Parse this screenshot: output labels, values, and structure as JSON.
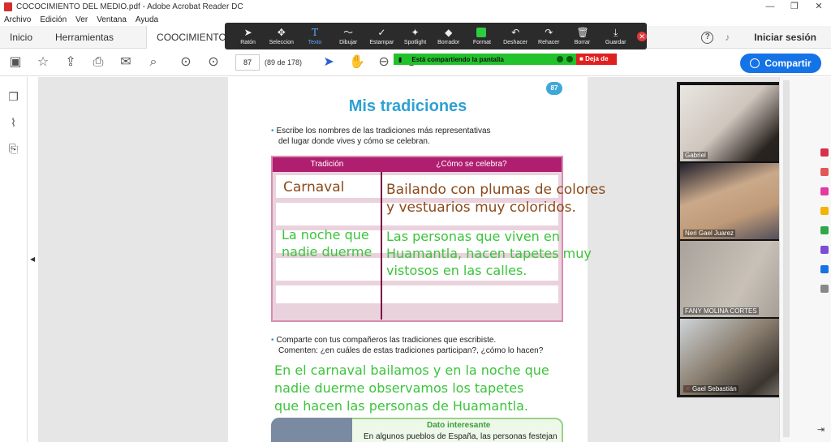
{
  "window": {
    "title": "COCOCIMIENTO DEL MEDIO.pdf - Adobe Acrobat Reader DC"
  },
  "menu": [
    "Archivo",
    "Edición",
    "Ver",
    "Ventana",
    "Ayuda"
  ],
  "tabs": {
    "home": "Inicio",
    "tools": "Herramientas",
    "doc": "COOCIMIENTO DE..."
  },
  "header": {
    "signin": "Iniciar sesión",
    "share_button": "Compartir"
  },
  "toolbar": {
    "page_value": "87",
    "page_of": "(89 de 178)"
  },
  "zoom_toolbar": {
    "tools": [
      "Ratón",
      "Seleccion",
      "Texto",
      "Dibujar",
      "Estampar",
      "Spotlight",
      "Borrador",
      "Format",
      "Deshacer",
      "Rehacer",
      "Borrar",
      "Guardar"
    ],
    "active_tool": "Texto"
  },
  "sharing": {
    "banner": "Está compartiendo la pantalla",
    "stop": "Deja de"
  },
  "page": {
    "number": "87",
    "title": "Mis tradiciones",
    "instruction_1_line1": "Escribe los nombres de las tradiciones más representativas",
    "instruction_1_line2": "del lugar donde vives y cómo se celebran.",
    "table_header_1": "Tradición",
    "table_header_2": "¿Cómo se celebra?",
    "instruction_2_line1": "Comparte con tus compañeros las tradiciones que escribiste.",
    "instruction_2_line2": "Comenten: ¿en cuáles de estas tradiciones participan?, ¿cómo lo hacen?",
    "dato_title": "Dato interesante",
    "dato_text": "En algunos pueblos de España, las personas festejan"
  },
  "handwriting": {
    "row1_tradition": "Carnaval",
    "row1_line1": "Bailando con plumas de colores",
    "row1_line2": "y vestuarios muy coloridos.",
    "row2_line1": "La noche que",
    "row2_line2": "nadie duerme",
    "row2_desc_line1": "Las personas que viven en",
    "row2_desc_line2": "Huamantla, hacen tapetes muy",
    "row2_desc_line3": "vistosos en las calles.",
    "answer_line1": "En el carnaval bailamos y en la noche que",
    "answer_line2": "nadie duerme observamos los tapetes",
    "answer_line3": "que hacen las personas de Huamantla."
  },
  "participants": [
    "Gabriel",
    "Neri Gael Juarez",
    "FANY MOLINA CORTES",
    "Gael Sebastián"
  ],
  "colors": {
    "accent_blue": "#1473e6",
    "title_blue": "#2ea1d3",
    "table_header": "#b01f6f",
    "handwriting_green": "#3bc43b",
    "handwriting_brown": "#8b4a1a",
    "share_green": "#22c22c"
  }
}
